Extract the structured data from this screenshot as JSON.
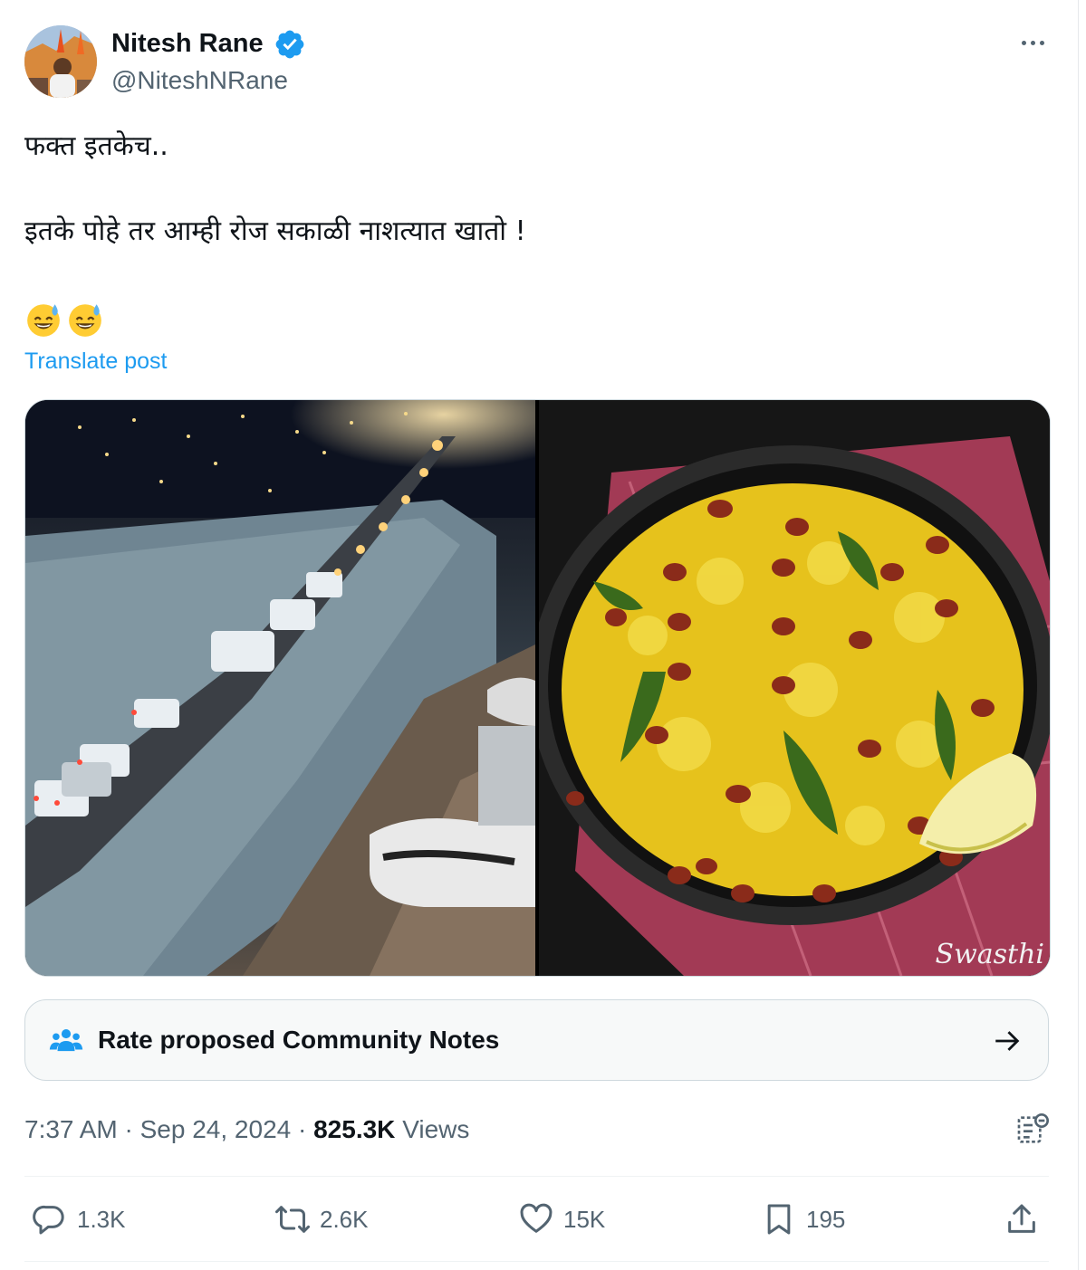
{
  "author": {
    "name": "Nitesh Rane",
    "handle": "@NiteshNRane",
    "verified": true
  },
  "post": {
    "line1": "फक्त इतकेच..",
    "line2": "इतके पोहे तर आम्ही रोज सकाळी नाशत्यात खातो !",
    "emojis": [
      "sweat-smile-emoji",
      "sweat-smile-emoji"
    ],
    "translate_label": "Translate post"
  },
  "media": {
    "left_image": "crowd-and-traffic-night-photo",
    "right_image": "poha-bowl-photo",
    "right_watermark": "Swasthi"
  },
  "community_notes": {
    "label": "Rate proposed Community Notes"
  },
  "meta": {
    "time": "7:37 AM",
    "separator": "·",
    "date": "Sep 24, 2024",
    "views_count": "825.3K",
    "views_label": "Views"
  },
  "actions": {
    "replies": "1.3K",
    "reposts": "2.6K",
    "likes": "15K",
    "bookmarks": "195"
  },
  "colors": {
    "accent": "#1d9bf0",
    "text": "#0f1419",
    "secondary": "#536471",
    "border": "#cfd9de"
  }
}
